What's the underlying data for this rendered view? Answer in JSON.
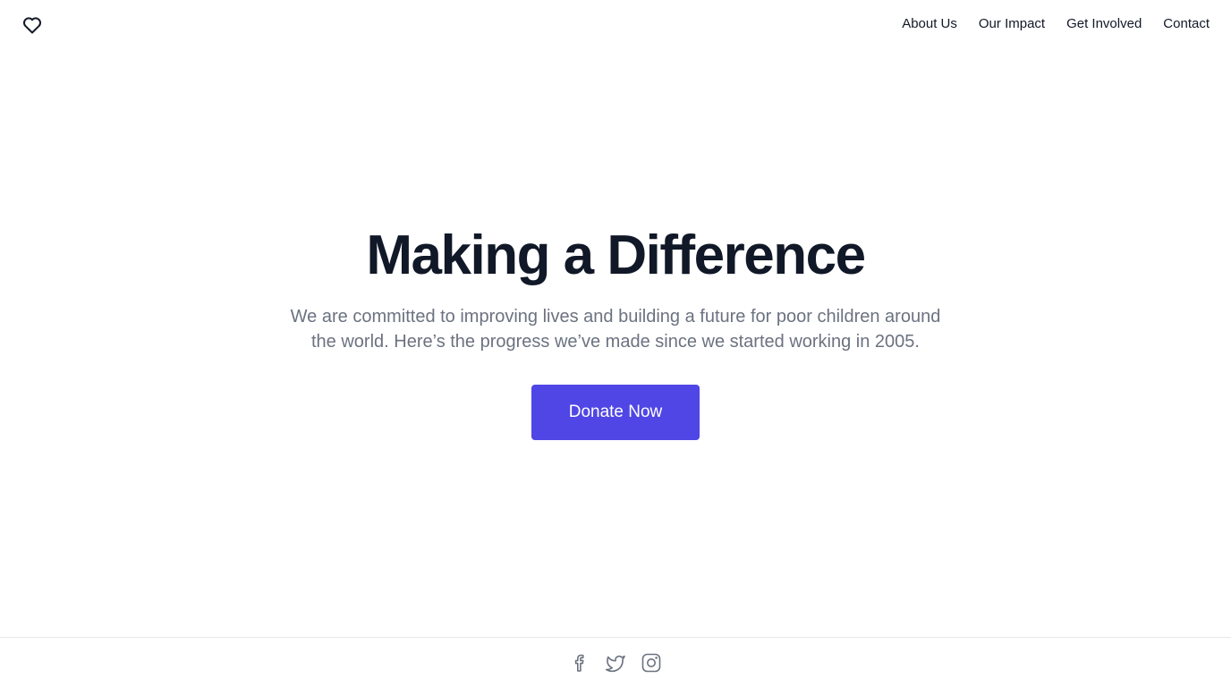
{
  "header": {
    "logo_icon": "heart-icon",
    "nav": [
      {
        "label": "About Us"
      },
      {
        "label": "Our Impact"
      },
      {
        "label": "Get Involved"
      },
      {
        "label": "Contact"
      }
    ]
  },
  "hero": {
    "title": "Making a Difference",
    "subtitle": "We are committed to improving lives and building a future for poor children around the world. Here’s the progress we’ve made since we started working in 2005.",
    "cta_label": "Donate Now"
  },
  "footer": {
    "social": [
      {
        "icon": "facebook-icon"
      },
      {
        "icon": "twitter-icon"
      },
      {
        "icon": "instagram-icon"
      }
    ]
  },
  "colors": {
    "accent": "#4f46e5",
    "heading": "#111827",
    "body_text": "#6b7280",
    "icon_gray": "#6b7280",
    "divider": "#e5e7eb"
  }
}
